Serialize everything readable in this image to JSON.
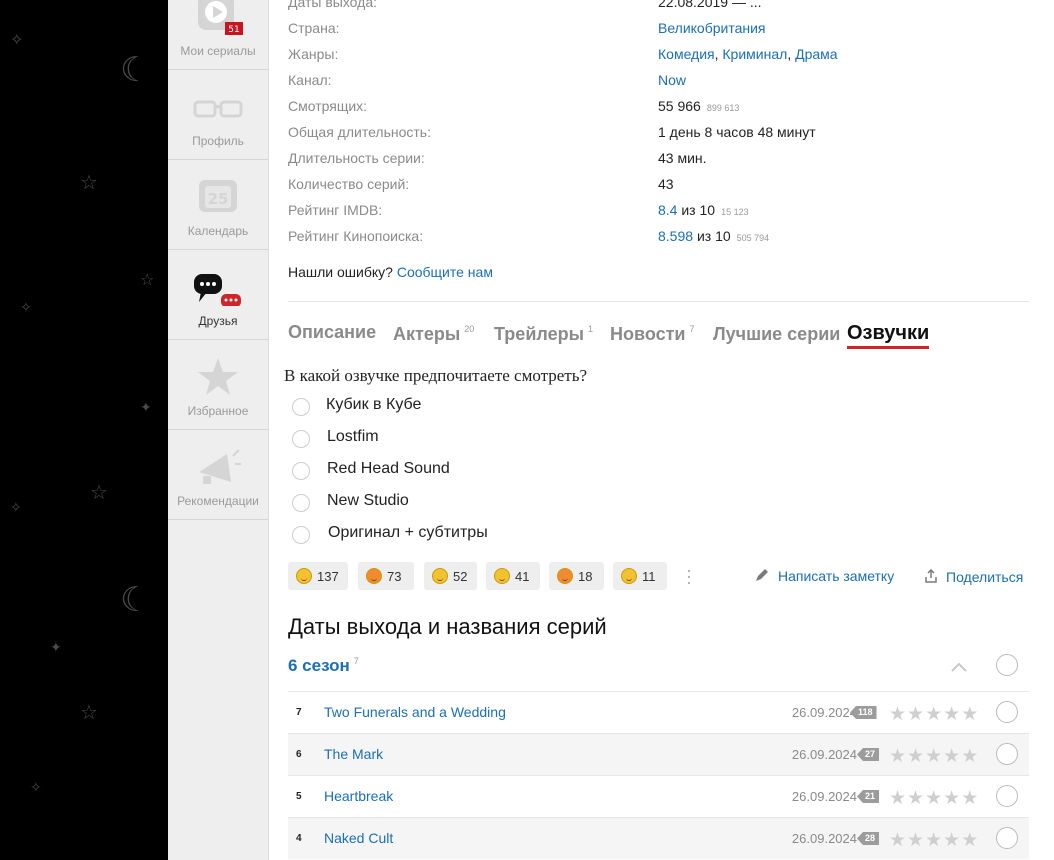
{
  "sidebar": {
    "items": [
      {
        "label": "Мои сериалы",
        "badge": "51",
        "icon": "play-icon"
      },
      {
        "label": "Профиль",
        "icon": "glasses-icon"
      },
      {
        "label": "Календарь",
        "icon": "calendar-icon",
        "day": "25"
      },
      {
        "label": "Друзья",
        "icon": "chat-icon",
        "active": true
      },
      {
        "label": "Избранное",
        "icon": "star-icon"
      },
      {
        "label": "Рекомендации",
        "icon": "megaphone-icon"
      }
    ]
  },
  "info": {
    "release_label": "Даты выхода:",
    "release_value": "22.08.2019 — ...",
    "country_label": "Страна:",
    "country_value": "Великобритания",
    "genres_label": "Жанры:",
    "genres": [
      "Комедия",
      "Криминал",
      "Драма"
    ],
    "channel_label": "Канал:",
    "channel_value": "Now",
    "watchers_label": "Смотрящих:",
    "watchers_value": "55 966",
    "watchers_sub": "899 613",
    "duration_label": "Общая длительность:",
    "duration_value": "1 день 8 часов 48 минут",
    "ep_len_label": "Длительность серии:",
    "ep_len_value": "43 мин.",
    "ep_count_label": "Количество серий:",
    "ep_count_value": "43",
    "imdb_label": "Рейтинг IMDB:",
    "imdb_value": "8.4",
    "imdb_of": "из 10",
    "imdb_votes": "15 123",
    "kp_label": "Рейтинг Кинопоиска:",
    "kp_value": "8.598",
    "kp_of": "из 10",
    "kp_votes": "505 794"
  },
  "error_report": {
    "text": "Нашли ошибку?",
    "link": "Сообщите нам"
  },
  "tabs": [
    {
      "label": "Описание",
      "count": ""
    },
    {
      "label": "Актеры",
      "count": "20"
    },
    {
      "label": "Трейлеры",
      "count": "1"
    },
    {
      "label": "Новости",
      "count": "7"
    },
    {
      "label": "Лучшие серии",
      "count": ""
    },
    {
      "label": "Озвучки",
      "count": "",
      "active": true
    }
  ],
  "poll": {
    "question": "В какой озвучке предпочитаете смотреть?",
    "options": [
      "Кубик в Кубе",
      "Lostfim",
      "Red Head Sound",
      "New Studio",
      "Оригинал + субтитры"
    ]
  },
  "reactions": [
    {
      "emoji": "laughing-face-icon",
      "count": "137"
    },
    {
      "emoji": "heart-eyes-face-icon",
      "count": "73"
    },
    {
      "emoji": "sleepy-face-icon",
      "count": "52"
    },
    {
      "emoji": "disappointed-face-icon",
      "count": "41"
    },
    {
      "emoji": "blushing-face-icon",
      "count": "18"
    },
    {
      "emoji": "grimacing-face-icon",
      "count": "11"
    }
  ],
  "actions": {
    "write_note": "Написать заметку",
    "share": "Поделиться"
  },
  "episodes_section": {
    "title": "Даты выхода и названия серий",
    "season_label": "6 сезон",
    "season_count": "7",
    "episodes": [
      {
        "num": "7",
        "title": "Two Funerals and a Wedding",
        "date": "26.09.2024",
        "comments": "118"
      },
      {
        "num": "6",
        "title": "The Mark",
        "date": "26.09.2024",
        "comments": "27"
      },
      {
        "num": "5",
        "title": "Heartbreak",
        "date": "26.09.2024",
        "comments": "21"
      },
      {
        "num": "4",
        "title": "Naked Cult",
        "date": "26.09.2024",
        "comments": "28"
      }
    ]
  },
  "colors": {
    "link": "#1a6fb5",
    "accent_red": "#d0242b",
    "sidebar_bg": "#eeeeee"
  }
}
